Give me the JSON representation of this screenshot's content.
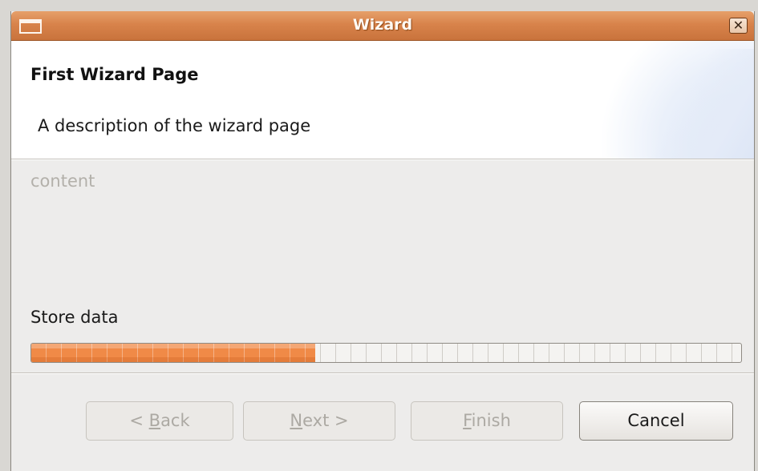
{
  "window": {
    "title": "Wizard",
    "close_symbol": "✕"
  },
  "header": {
    "page_title": "First Wizard Page",
    "description": "A description of the wizard page"
  },
  "content": {
    "placeholder": "content"
  },
  "progress": {
    "label": "Store data",
    "percent": 40,
    "color": "#f08a47"
  },
  "buttons": {
    "back": {
      "mnemonic": "B",
      "rest": "ack",
      "prefix": "< ",
      "suffix": "",
      "enabled": false
    },
    "next": {
      "mnemonic": "N",
      "rest": "ext",
      "prefix": "",
      "suffix": " >",
      "enabled": false
    },
    "finish": {
      "mnemonic": "F",
      "rest": "inish",
      "prefix": "",
      "suffix": "",
      "enabled": false
    },
    "cancel": {
      "label": "Cancel",
      "enabled": true
    }
  }
}
